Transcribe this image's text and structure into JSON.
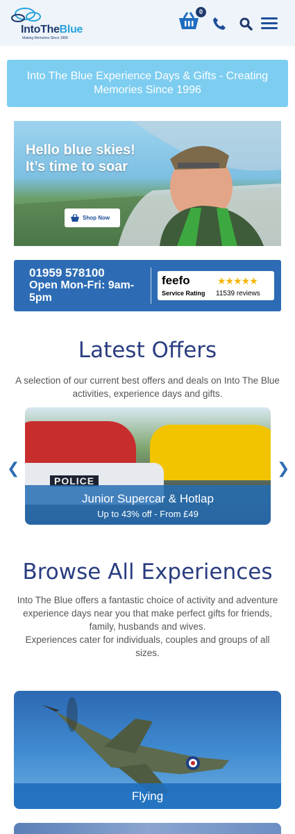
{
  "header": {
    "logo_main": "IntoThe",
    "logo_accent": "Blue",
    "logo_tagline": "Making Memories Since 1996",
    "basket_count": "0",
    "icons": [
      "logo-cloud-icon",
      "basket-icon",
      "phone-icon",
      "search-icon",
      "menu-icon"
    ]
  },
  "banner": {
    "text": "Into The Blue Experience Days & Gifts - Creating Memories Since 1996"
  },
  "hero": {
    "title_line1": "Hello blue skies!",
    "title_line2": "It’s time to soar",
    "button_label": "Shop Now"
  },
  "contact": {
    "phone": "01959 578100",
    "hours": "Open Mon-Fri: 9am-5pm",
    "feefo_logo": "feefo",
    "feefo_label": "Service Rating",
    "feefo_stars": "★★★★★",
    "feefo_reviews": "11539 reviews"
  },
  "offers": {
    "heading": "Latest Offers",
    "intro": "A selection of our current best offers and deals on Into The Blue activities, experience days and gifts.",
    "card": {
      "title": "Junior Supercar & Hotlap",
      "subtitle": "Up to 43% off - From £49",
      "police_text": "POLICE"
    },
    "prev_arrow": "❮",
    "next_arrow": "❯"
  },
  "browse": {
    "heading": "Browse All Experiences",
    "intro": "Into The Blue offers a fantastic choice of activity and adventure experience days near you that make perfect gifts for friends, family, husbands and wives.",
    "intro2": "Experiences cater for individuals, couples and groups of all sizes.",
    "categories": [
      {
        "label": "Flying"
      }
    ]
  },
  "colors": {
    "brand_navy": "#1f3a6e",
    "brand_blue": "#2d6cb5",
    "banner_light_blue": "#7dcdf1",
    "heading_blue": "#2a3d80"
  }
}
